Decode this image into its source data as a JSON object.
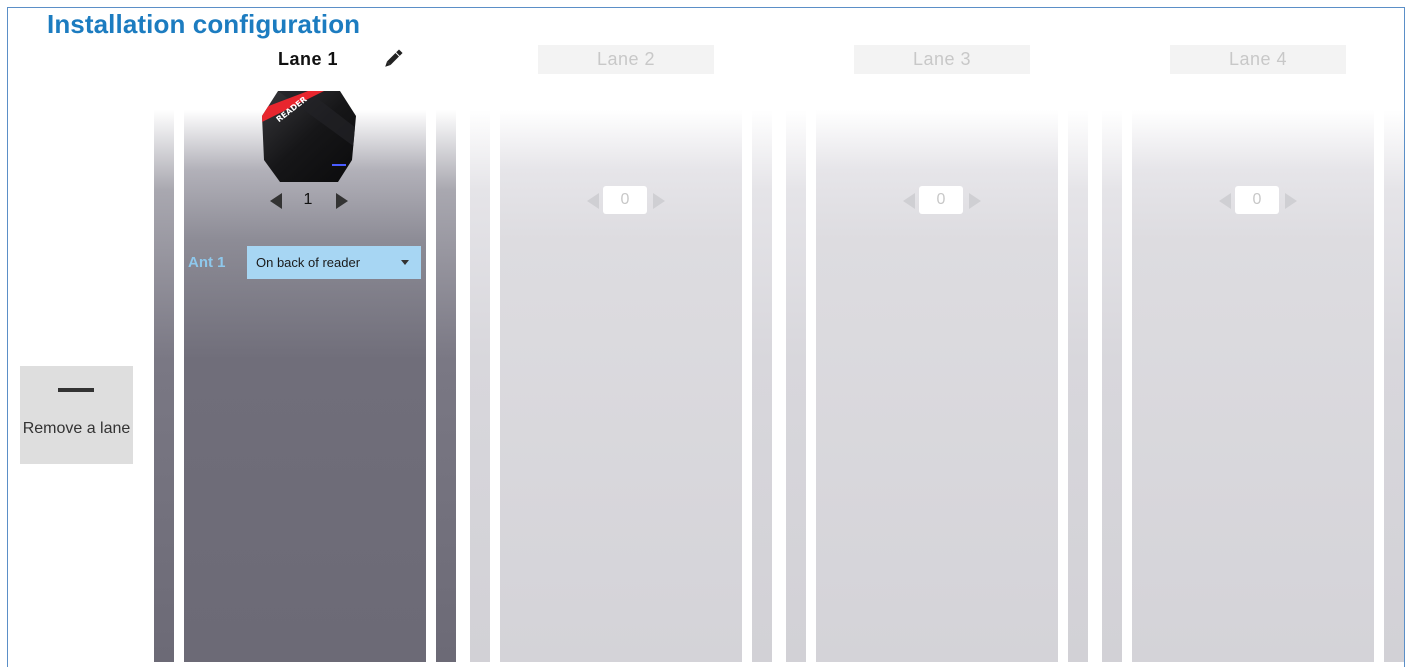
{
  "title": "Installation configuration",
  "remove_lane": {
    "label": "Remove a lane",
    "icon": "minus-icon"
  },
  "lanes": [
    {
      "label": "Lane 1",
      "state": "active",
      "reader_count": "1",
      "reader_badge": "READER",
      "antennas": [
        {
          "label": "Ant 1",
          "position": "On back of reader"
        }
      ]
    },
    {
      "label": "Lane 2",
      "state": "inactive",
      "reader_count": "0"
    },
    {
      "label": "Lane 3",
      "state": "inactive",
      "reader_count": "0"
    },
    {
      "label": "Lane 4",
      "state": "inactive",
      "reader_count": "0"
    }
  ],
  "colors": {
    "title": "#1c7cc0",
    "frame_border": "#5b8fc7",
    "active_lane": "#6c6a76",
    "inactive_lane": "#d4d3d8",
    "antenna_select": "#a7d6f3",
    "antenna_label": "#8ec8ec",
    "reader_ribbon": "#e8262e"
  }
}
